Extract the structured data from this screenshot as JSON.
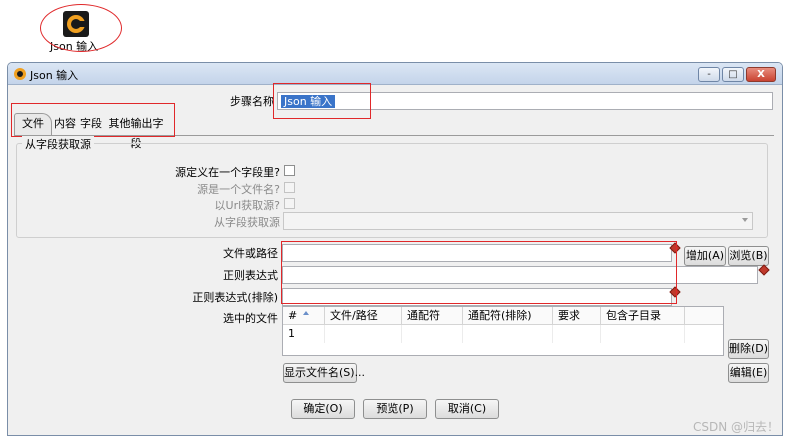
{
  "desktop": {
    "icon_label": "Json 输入"
  },
  "window": {
    "title": "Json 输入",
    "minimize": "-",
    "restore": "□",
    "close": "X"
  },
  "step": {
    "label": "步骤名称",
    "value": "Json 输入"
  },
  "tabs": [
    {
      "label": "文件",
      "active": true
    },
    {
      "label": "内容",
      "active": false
    },
    {
      "label": "字段",
      "active": false
    },
    {
      "label": "其他输出字段",
      "active": false
    }
  ],
  "source_group": {
    "title": "从字段获取源",
    "defined_in_field_label": "源定义在一个字段里?",
    "is_filename_label": "源是一个文件名?",
    "is_url_label": "以Url获取源?",
    "source_field_label": "从字段获取源",
    "source_field_value": ""
  },
  "file_path": {
    "label": "文件或路径",
    "value": ""
  },
  "regex": {
    "label": "正则表达式",
    "value": ""
  },
  "regex_exclude": {
    "label": "正则表达式(排除)",
    "value": ""
  },
  "buttons": {
    "add": "增加(A)",
    "browse": "浏览(B)",
    "delete": "删除(D)",
    "edit": "编辑(E)",
    "show_filenames": "显示文件名(S)...",
    "ok": "确定(O)",
    "preview": "预览(P)",
    "cancel": "取消(C)"
  },
  "selected_files": {
    "label": "选中的文件",
    "columns": [
      "#",
      "文件/路径",
      "通配符",
      "通配符(排除)",
      "要求",
      "包含子目录"
    ],
    "rows": [
      [
        "1",
        "",
        "",
        "",
        "",
        ""
      ]
    ]
  },
  "watermark": "CSDN @归去！"
}
